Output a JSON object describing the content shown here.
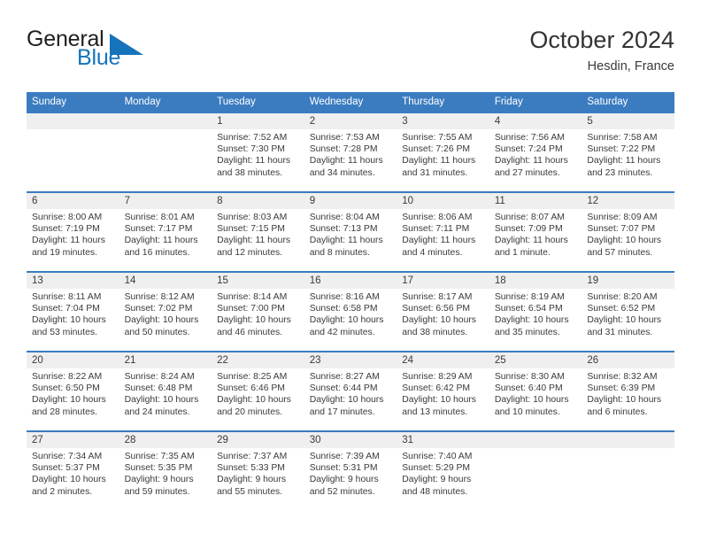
{
  "brand": {
    "name_part1": "General",
    "name_part2": "Blue",
    "logo_icon": "blue-triangle-icon",
    "accent_color": "#1573bb"
  },
  "header": {
    "title": "October 2024",
    "location": "Hesdin, France"
  },
  "theme": {
    "header_band": "#3b7cc0",
    "daynum_band": "#efefef",
    "text": "#3a3a3a"
  },
  "calendar": {
    "weekday_headers": [
      "Sunday",
      "Monday",
      "Tuesday",
      "Wednesday",
      "Thursday",
      "Friday",
      "Saturday"
    ],
    "labels": {
      "sunrise": "Sunrise:",
      "sunset": "Sunset:",
      "daylight": "Daylight:"
    },
    "weeks": [
      [
        {
          "day": ""
        },
        {
          "day": ""
        },
        {
          "day": "1",
          "sunrise": "Sunrise: 7:52 AM",
          "sunset": "Sunset: 7:30 PM",
          "daylight_line1": "Daylight: 11 hours",
          "daylight_line2": "and 38 minutes."
        },
        {
          "day": "2",
          "sunrise": "Sunrise: 7:53 AM",
          "sunset": "Sunset: 7:28 PM",
          "daylight_line1": "Daylight: 11 hours",
          "daylight_line2": "and 34 minutes."
        },
        {
          "day": "3",
          "sunrise": "Sunrise: 7:55 AM",
          "sunset": "Sunset: 7:26 PM",
          "daylight_line1": "Daylight: 11 hours",
          "daylight_line2": "and 31 minutes."
        },
        {
          "day": "4",
          "sunrise": "Sunrise: 7:56 AM",
          "sunset": "Sunset: 7:24 PM",
          "daylight_line1": "Daylight: 11 hours",
          "daylight_line2": "and 27 minutes."
        },
        {
          "day": "5",
          "sunrise": "Sunrise: 7:58 AM",
          "sunset": "Sunset: 7:22 PM",
          "daylight_line1": "Daylight: 11 hours",
          "daylight_line2": "and 23 minutes."
        }
      ],
      [
        {
          "day": "6",
          "sunrise": "Sunrise: 8:00 AM",
          "sunset": "Sunset: 7:19 PM",
          "daylight_line1": "Daylight: 11 hours",
          "daylight_line2": "and 19 minutes."
        },
        {
          "day": "7",
          "sunrise": "Sunrise: 8:01 AM",
          "sunset": "Sunset: 7:17 PM",
          "daylight_line1": "Daylight: 11 hours",
          "daylight_line2": "and 16 minutes."
        },
        {
          "day": "8",
          "sunrise": "Sunrise: 8:03 AM",
          "sunset": "Sunset: 7:15 PM",
          "daylight_line1": "Daylight: 11 hours",
          "daylight_line2": "and 12 minutes."
        },
        {
          "day": "9",
          "sunrise": "Sunrise: 8:04 AM",
          "sunset": "Sunset: 7:13 PM",
          "daylight_line1": "Daylight: 11 hours",
          "daylight_line2": "and 8 minutes."
        },
        {
          "day": "10",
          "sunrise": "Sunrise: 8:06 AM",
          "sunset": "Sunset: 7:11 PM",
          "daylight_line1": "Daylight: 11 hours",
          "daylight_line2": "and 4 minutes."
        },
        {
          "day": "11",
          "sunrise": "Sunrise: 8:07 AM",
          "sunset": "Sunset: 7:09 PM",
          "daylight_line1": "Daylight: 11 hours",
          "daylight_line2": "and 1 minute."
        },
        {
          "day": "12",
          "sunrise": "Sunrise: 8:09 AM",
          "sunset": "Sunset: 7:07 PM",
          "daylight_line1": "Daylight: 10 hours",
          "daylight_line2": "and 57 minutes."
        }
      ],
      [
        {
          "day": "13",
          "sunrise": "Sunrise: 8:11 AM",
          "sunset": "Sunset: 7:04 PM",
          "daylight_line1": "Daylight: 10 hours",
          "daylight_line2": "and 53 minutes."
        },
        {
          "day": "14",
          "sunrise": "Sunrise: 8:12 AM",
          "sunset": "Sunset: 7:02 PM",
          "daylight_line1": "Daylight: 10 hours",
          "daylight_line2": "and 50 minutes."
        },
        {
          "day": "15",
          "sunrise": "Sunrise: 8:14 AM",
          "sunset": "Sunset: 7:00 PM",
          "daylight_line1": "Daylight: 10 hours",
          "daylight_line2": "and 46 minutes."
        },
        {
          "day": "16",
          "sunrise": "Sunrise: 8:16 AM",
          "sunset": "Sunset: 6:58 PM",
          "daylight_line1": "Daylight: 10 hours",
          "daylight_line2": "and 42 minutes."
        },
        {
          "day": "17",
          "sunrise": "Sunrise: 8:17 AM",
          "sunset": "Sunset: 6:56 PM",
          "daylight_line1": "Daylight: 10 hours",
          "daylight_line2": "and 38 minutes."
        },
        {
          "day": "18",
          "sunrise": "Sunrise: 8:19 AM",
          "sunset": "Sunset: 6:54 PM",
          "daylight_line1": "Daylight: 10 hours",
          "daylight_line2": "and 35 minutes."
        },
        {
          "day": "19",
          "sunrise": "Sunrise: 8:20 AM",
          "sunset": "Sunset: 6:52 PM",
          "daylight_line1": "Daylight: 10 hours",
          "daylight_line2": "and 31 minutes."
        }
      ],
      [
        {
          "day": "20",
          "sunrise": "Sunrise: 8:22 AM",
          "sunset": "Sunset: 6:50 PM",
          "daylight_line1": "Daylight: 10 hours",
          "daylight_line2": "and 28 minutes."
        },
        {
          "day": "21",
          "sunrise": "Sunrise: 8:24 AM",
          "sunset": "Sunset: 6:48 PM",
          "daylight_line1": "Daylight: 10 hours",
          "daylight_line2": "and 24 minutes."
        },
        {
          "day": "22",
          "sunrise": "Sunrise: 8:25 AM",
          "sunset": "Sunset: 6:46 PM",
          "daylight_line1": "Daylight: 10 hours",
          "daylight_line2": "and 20 minutes."
        },
        {
          "day": "23",
          "sunrise": "Sunrise: 8:27 AM",
          "sunset": "Sunset: 6:44 PM",
          "daylight_line1": "Daylight: 10 hours",
          "daylight_line2": "and 17 minutes."
        },
        {
          "day": "24",
          "sunrise": "Sunrise: 8:29 AM",
          "sunset": "Sunset: 6:42 PM",
          "daylight_line1": "Daylight: 10 hours",
          "daylight_line2": "and 13 minutes."
        },
        {
          "day": "25",
          "sunrise": "Sunrise: 8:30 AM",
          "sunset": "Sunset: 6:40 PM",
          "daylight_line1": "Daylight: 10 hours",
          "daylight_line2": "and 10 minutes."
        },
        {
          "day": "26",
          "sunrise": "Sunrise: 8:32 AM",
          "sunset": "Sunset: 6:39 PM",
          "daylight_line1": "Daylight: 10 hours",
          "daylight_line2": "and 6 minutes."
        }
      ],
      [
        {
          "day": "27",
          "sunrise": "Sunrise: 7:34 AM",
          "sunset": "Sunset: 5:37 PM",
          "daylight_line1": "Daylight: 10 hours",
          "daylight_line2": "and 2 minutes."
        },
        {
          "day": "28",
          "sunrise": "Sunrise: 7:35 AM",
          "sunset": "Sunset: 5:35 PM",
          "daylight_line1": "Daylight: 9 hours",
          "daylight_line2": "and 59 minutes."
        },
        {
          "day": "29",
          "sunrise": "Sunrise: 7:37 AM",
          "sunset": "Sunset: 5:33 PM",
          "daylight_line1": "Daylight: 9 hours",
          "daylight_line2": "and 55 minutes."
        },
        {
          "day": "30",
          "sunrise": "Sunrise: 7:39 AM",
          "sunset": "Sunset: 5:31 PM",
          "daylight_line1": "Daylight: 9 hours",
          "daylight_line2": "and 52 minutes."
        },
        {
          "day": "31",
          "sunrise": "Sunrise: 7:40 AM",
          "sunset": "Sunset: 5:29 PM",
          "daylight_line1": "Daylight: 9 hours",
          "daylight_line2": "and 48 minutes."
        },
        {
          "day": ""
        },
        {
          "day": ""
        }
      ]
    ]
  }
}
